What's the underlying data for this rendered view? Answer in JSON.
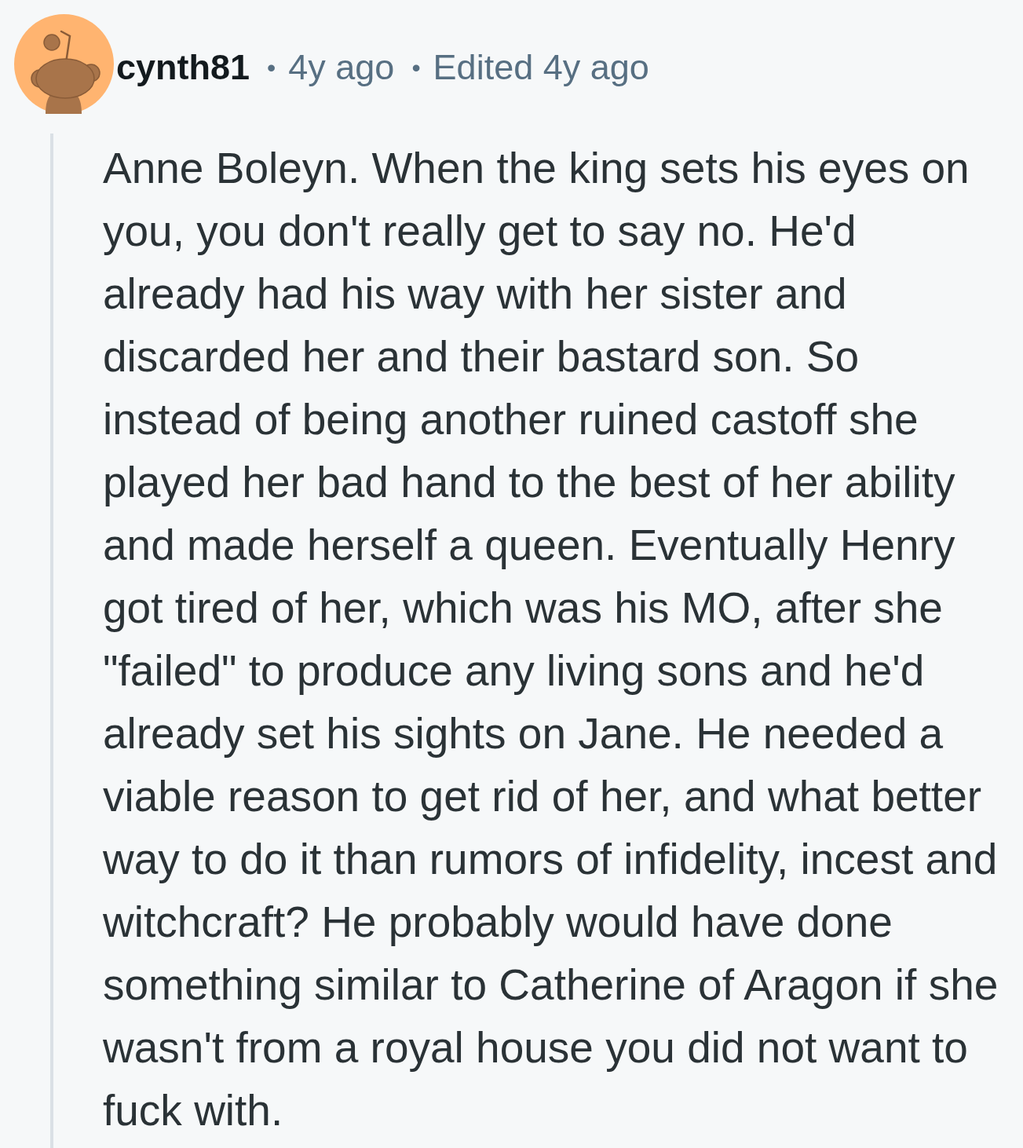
{
  "comment": {
    "author": "cynth81",
    "meta": [
      {
        "kind": "separator",
        "text": "•"
      },
      {
        "kind": "time",
        "text": "4y ago"
      },
      {
        "kind": "separator",
        "text": "•"
      },
      {
        "kind": "time",
        "text": "Edited 4y ago"
      }
    ],
    "body": "Anne Boleyn. When the king sets his eyes on you, you don't really get to say no. He'd already had his way with her sister and discarded her and their bastard son. So instead of being another ruined castoff she played her bad hand to the best of her ability and made herself a queen. Eventually Henry got tired of her, which was his MO, after she \"failed\" to produce any living sons and he'd already set his sights on Jane. He needed a viable reason to get rid of her, and what better way to do it than rumors of infidelity, incest and witchcraft? He probably would have done something similar to Catherine of Aragon if she wasn't from a royal house you did not want to fuck with."
  }
}
